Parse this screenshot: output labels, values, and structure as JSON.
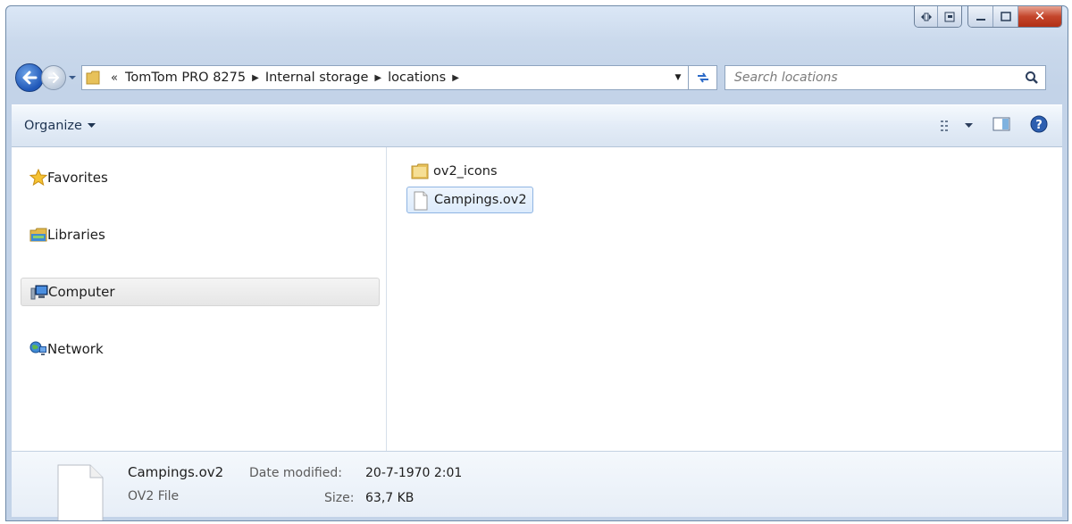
{
  "window": {
    "caption_buttons": [
      "restore-down",
      "pin",
      "minimize",
      "maximize",
      "close"
    ]
  },
  "nav": {
    "overflow_chevron": "«",
    "breadcrumb": [
      "TomTom PRO 8275",
      "Internal storage",
      "locations"
    ],
    "search_placeholder": "Search locations"
  },
  "toolbar": {
    "organize_label": "Organize"
  },
  "sidebar": {
    "items": [
      {
        "label": "Favorites",
        "icon": "star-icon"
      },
      {
        "label": "Libraries",
        "icon": "library-icon"
      },
      {
        "label": "Computer",
        "icon": "computer-icon",
        "selected": true
      },
      {
        "label": "Network",
        "icon": "network-icon"
      }
    ]
  },
  "files": [
    {
      "name": "ov2_icons",
      "icon": "folder-icon"
    },
    {
      "name": "Campings.ov2",
      "icon": "document-icon",
      "selected": true
    }
  ],
  "details": {
    "name": "Campings.ov2",
    "type": "OV2 File",
    "modified_label": "Date modified:",
    "modified_value": "20-7-1970 2:01",
    "size_label": "Size:",
    "size_value": "63,7 KB"
  },
  "colors": {
    "chrome": "#c3d3e8",
    "selection_border": "#8fb5e3",
    "close_button": "#c4452b"
  }
}
